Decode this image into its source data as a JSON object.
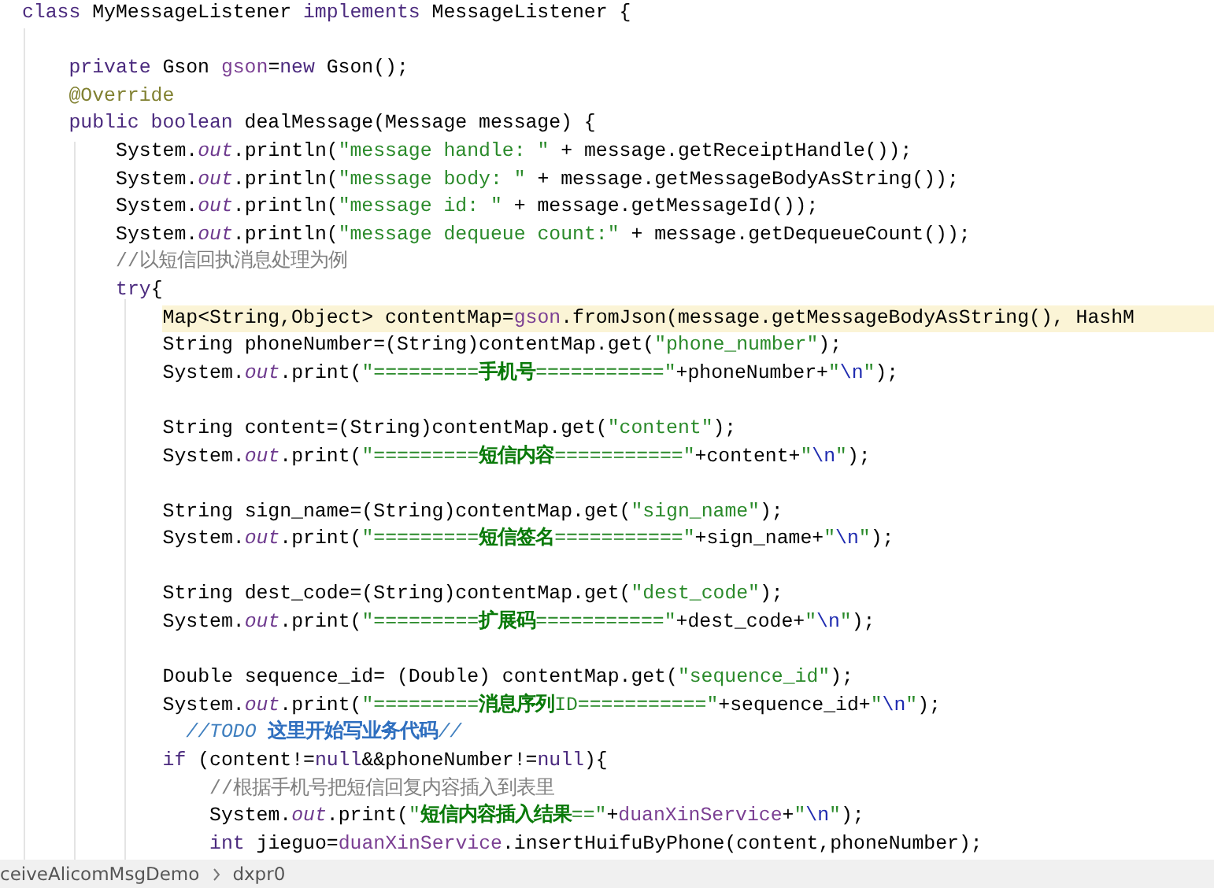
{
  "editor": {
    "lines": [
      {
        "kind": "code",
        "highlighted": false,
        "tokens": [
          {
            "kind": "keyword",
            "text": "class "
          },
          {
            "kind": "plain",
            "text": "MyMessageListener "
          },
          {
            "kind": "keyword",
            "text": "implements "
          },
          {
            "kind": "plain",
            "text": "MessageListener {"
          }
        ]
      },
      {
        "kind": "blank"
      },
      {
        "kind": "code",
        "highlighted": false,
        "tokens": [
          {
            "kind": "keyword",
            "text": "    private "
          },
          {
            "kind": "plain",
            "text": "Gson "
          },
          {
            "kind": "field",
            "text": "gson"
          },
          {
            "kind": "plain",
            "text": "="
          },
          {
            "kind": "keyword",
            "text": "new "
          },
          {
            "kind": "plain",
            "text": "Gson();"
          }
        ]
      },
      {
        "kind": "code",
        "highlighted": false,
        "tokens": [
          {
            "kind": "annotation",
            "text": "    @Override"
          }
        ]
      },
      {
        "kind": "code",
        "highlighted": false,
        "tokens": [
          {
            "kind": "keyword",
            "text": "    public boolean "
          },
          {
            "kind": "plain",
            "text": "dealMessage(Message message) {"
          }
        ]
      },
      {
        "kind": "code",
        "highlighted": false,
        "tokens": [
          {
            "kind": "plain",
            "text": "        System."
          },
          {
            "kind": "static",
            "text": "out"
          },
          {
            "kind": "plain",
            "text": ".println("
          },
          {
            "kind": "string",
            "text": "\"message handle: \""
          },
          {
            "kind": "plain",
            "text": " + message.getReceiptHandle());"
          }
        ]
      },
      {
        "kind": "code",
        "highlighted": false,
        "tokens": [
          {
            "kind": "plain",
            "text": "        System."
          },
          {
            "kind": "static",
            "text": "out"
          },
          {
            "kind": "plain",
            "text": ".println("
          },
          {
            "kind": "string",
            "text": "\"message body: \""
          },
          {
            "kind": "plain",
            "text": " + message.getMessageBodyAsString());"
          }
        ]
      },
      {
        "kind": "code",
        "highlighted": false,
        "tokens": [
          {
            "kind": "plain",
            "text": "        System."
          },
          {
            "kind": "static",
            "text": "out"
          },
          {
            "kind": "plain",
            "text": ".println("
          },
          {
            "kind": "string",
            "text": "\"message id: \""
          },
          {
            "kind": "plain",
            "text": " + message.getMessageId());"
          }
        ]
      },
      {
        "kind": "code",
        "highlighted": false,
        "tokens": [
          {
            "kind": "plain",
            "text": "        System."
          },
          {
            "kind": "static",
            "text": "out"
          },
          {
            "kind": "plain",
            "text": ".println("
          },
          {
            "kind": "string",
            "text": "\"message dequeue count:\""
          },
          {
            "kind": "plain",
            "text": " + message.getDequeueCount());"
          }
        ]
      },
      {
        "kind": "code",
        "highlighted": false,
        "tokens": [
          {
            "kind": "comment",
            "text": "        //以短信回执消息处理为例"
          }
        ]
      },
      {
        "kind": "code",
        "highlighted": false,
        "tokens": [
          {
            "kind": "keyword",
            "text": "        try"
          },
          {
            "kind": "plain",
            "text": "{"
          }
        ]
      },
      {
        "kind": "code",
        "highlighted": true,
        "tokens": [
          {
            "kind": "plain",
            "text": "            Map<String,Object> contentMap="
          },
          {
            "kind": "field",
            "text": "gson"
          },
          {
            "kind": "plain",
            "text": ".fromJson(message.getMessageBodyAsString(), HashM"
          }
        ]
      },
      {
        "kind": "code",
        "highlighted": false,
        "tokens": [
          {
            "kind": "plain",
            "text": "            String phoneNumber=(String)contentMap.get("
          },
          {
            "kind": "string",
            "text": "\"phone_number\""
          },
          {
            "kind": "plain",
            "text": ");"
          }
        ]
      },
      {
        "kind": "code",
        "highlighted": false,
        "tokens": [
          {
            "kind": "plain",
            "text": "            System."
          },
          {
            "kind": "static",
            "text": "out"
          },
          {
            "kind": "plain",
            "text": ".print("
          },
          {
            "kind": "string",
            "text": "\"========="
          },
          {
            "kind": "string-cjk",
            "text": "手机号"
          },
          {
            "kind": "string",
            "text": "===========\""
          },
          {
            "kind": "plain",
            "text": "+phoneNumber+"
          },
          {
            "kind": "string",
            "text": "\""
          },
          {
            "kind": "escape",
            "text": "\\n"
          },
          {
            "kind": "string",
            "text": "\""
          },
          {
            "kind": "plain",
            "text": ");"
          }
        ]
      },
      {
        "kind": "blank"
      },
      {
        "kind": "code",
        "highlighted": false,
        "tokens": [
          {
            "kind": "plain",
            "text": "            String content=(String)contentMap.get("
          },
          {
            "kind": "string",
            "text": "\"content\""
          },
          {
            "kind": "plain",
            "text": ");"
          }
        ]
      },
      {
        "kind": "code",
        "highlighted": false,
        "tokens": [
          {
            "kind": "plain",
            "text": "            System."
          },
          {
            "kind": "static",
            "text": "out"
          },
          {
            "kind": "plain",
            "text": ".print("
          },
          {
            "kind": "string",
            "text": "\"========="
          },
          {
            "kind": "string-cjk",
            "text": "短信内容"
          },
          {
            "kind": "string",
            "text": "===========\""
          },
          {
            "kind": "plain",
            "text": "+content+"
          },
          {
            "kind": "string",
            "text": "\""
          },
          {
            "kind": "escape",
            "text": "\\n"
          },
          {
            "kind": "string",
            "text": "\""
          },
          {
            "kind": "plain",
            "text": ");"
          }
        ]
      },
      {
        "kind": "blank"
      },
      {
        "kind": "code",
        "highlighted": false,
        "tokens": [
          {
            "kind": "plain",
            "text": "            String sign_name=(String)contentMap.get("
          },
          {
            "kind": "string",
            "text": "\"sign_name\""
          },
          {
            "kind": "plain",
            "text": ");"
          }
        ]
      },
      {
        "kind": "code",
        "highlighted": false,
        "tokens": [
          {
            "kind": "plain",
            "text": "            System."
          },
          {
            "kind": "static",
            "text": "out"
          },
          {
            "kind": "plain",
            "text": ".print("
          },
          {
            "kind": "string",
            "text": "\"========="
          },
          {
            "kind": "string-cjk",
            "text": "短信签名"
          },
          {
            "kind": "string",
            "text": "===========\""
          },
          {
            "kind": "plain",
            "text": "+sign_name+"
          },
          {
            "kind": "string",
            "text": "\""
          },
          {
            "kind": "escape",
            "text": "\\n"
          },
          {
            "kind": "string",
            "text": "\""
          },
          {
            "kind": "plain",
            "text": ");"
          }
        ]
      },
      {
        "kind": "blank"
      },
      {
        "kind": "code",
        "highlighted": false,
        "tokens": [
          {
            "kind": "plain",
            "text": "            String dest_code=(String)contentMap.get("
          },
          {
            "kind": "string",
            "text": "\"dest_code\""
          },
          {
            "kind": "plain",
            "text": ");"
          }
        ]
      },
      {
        "kind": "code",
        "highlighted": false,
        "tokens": [
          {
            "kind": "plain",
            "text": "            System."
          },
          {
            "kind": "static",
            "text": "out"
          },
          {
            "kind": "plain",
            "text": ".print("
          },
          {
            "kind": "string",
            "text": "\"========="
          },
          {
            "kind": "string-cjk",
            "text": "扩展码"
          },
          {
            "kind": "string",
            "text": "===========\""
          },
          {
            "kind": "plain",
            "text": "+dest_code+"
          },
          {
            "kind": "string",
            "text": "\""
          },
          {
            "kind": "escape",
            "text": "\\n"
          },
          {
            "kind": "string",
            "text": "\""
          },
          {
            "kind": "plain",
            "text": ");"
          }
        ]
      },
      {
        "kind": "blank"
      },
      {
        "kind": "code",
        "highlighted": false,
        "tokens": [
          {
            "kind": "plain",
            "text": "            Double sequence_id= (Double) contentMap.get("
          },
          {
            "kind": "string",
            "text": "\"sequence_id\""
          },
          {
            "kind": "plain",
            "text": ");"
          }
        ]
      },
      {
        "kind": "code",
        "highlighted": false,
        "tokens": [
          {
            "kind": "plain",
            "text": "            System."
          },
          {
            "kind": "static",
            "text": "out"
          },
          {
            "kind": "plain",
            "text": ".print("
          },
          {
            "kind": "string",
            "text": "\"========="
          },
          {
            "kind": "string-cjk",
            "text": "消息序列"
          },
          {
            "kind": "string",
            "text": "ID===========\""
          },
          {
            "kind": "plain",
            "text": "+sequence_id+"
          },
          {
            "kind": "string",
            "text": "\""
          },
          {
            "kind": "escape",
            "text": "\\n"
          },
          {
            "kind": "string",
            "text": "\""
          },
          {
            "kind": "plain",
            "text": ");"
          }
        ]
      },
      {
        "kind": "code",
        "highlighted": false,
        "tokens": [
          {
            "kind": "task",
            "text": "              //TODO"
          },
          {
            "kind": "task-cjk",
            "text": " 这里开始写业务代码"
          },
          {
            "kind": "task",
            "text": "//"
          }
        ]
      },
      {
        "kind": "code",
        "highlighted": false,
        "tokens": [
          {
            "kind": "keyword",
            "text": "            if "
          },
          {
            "kind": "plain",
            "text": "(content!="
          },
          {
            "kind": "keyword",
            "text": "null"
          },
          {
            "kind": "plain",
            "text": "&&phoneNumber!="
          },
          {
            "kind": "keyword",
            "text": "null"
          },
          {
            "kind": "plain",
            "text": "){"
          }
        ]
      },
      {
        "kind": "code",
        "highlighted": false,
        "tokens": [
          {
            "kind": "comment",
            "text": "                //根据手机号把短信回复内容插入到表里"
          }
        ]
      },
      {
        "kind": "code",
        "highlighted": false,
        "tokens": [
          {
            "kind": "plain",
            "text": "                System."
          },
          {
            "kind": "static",
            "text": "out"
          },
          {
            "kind": "plain",
            "text": ".print("
          },
          {
            "kind": "string",
            "text": "\""
          },
          {
            "kind": "string-cjk",
            "text": "短信内容插入结果"
          },
          {
            "kind": "string",
            "text": "==\""
          },
          {
            "kind": "plain",
            "text": "+"
          },
          {
            "kind": "field",
            "text": "duanXinService"
          },
          {
            "kind": "plain",
            "text": "+"
          },
          {
            "kind": "string",
            "text": "\""
          },
          {
            "kind": "escape",
            "text": "\\n"
          },
          {
            "kind": "string",
            "text": "\""
          },
          {
            "kind": "plain",
            "text": ");"
          }
        ]
      },
      {
        "kind": "code",
        "highlighted": false,
        "tokens": [
          {
            "kind": "keyword",
            "text": "                int "
          },
          {
            "kind": "plain",
            "text": "jieguo="
          },
          {
            "kind": "field",
            "text": "duanXinService"
          },
          {
            "kind": "plain",
            "text": ".insertHuifuByPhone(content,phoneNumber);"
          }
        ]
      }
    ]
  },
  "breadcrumb": [
    "ceiveAlicomMsgDemo",
    "dxpr0"
  ]
}
